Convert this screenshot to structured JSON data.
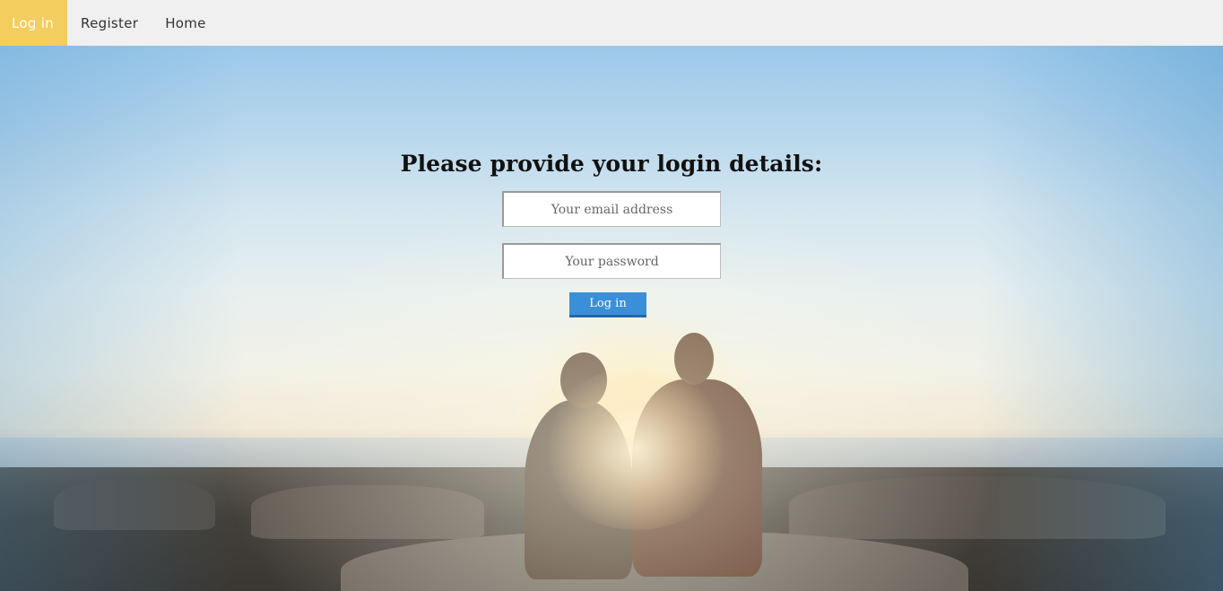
{
  "nav": {
    "items": [
      {
        "label": "Log in",
        "active": true
      },
      {
        "label": "Register",
        "active": false
      },
      {
        "label": "Home",
        "active": false
      }
    ],
    "active_color": "#f3cd5e"
  },
  "login": {
    "title": "Please provide your login details:",
    "email_placeholder": "Your email address",
    "password_placeholder": "Your password",
    "submit_label": "Log in",
    "button_color": "#3a8fd9"
  },
  "background": {
    "description_icon": "sunset-couple-photo"
  }
}
